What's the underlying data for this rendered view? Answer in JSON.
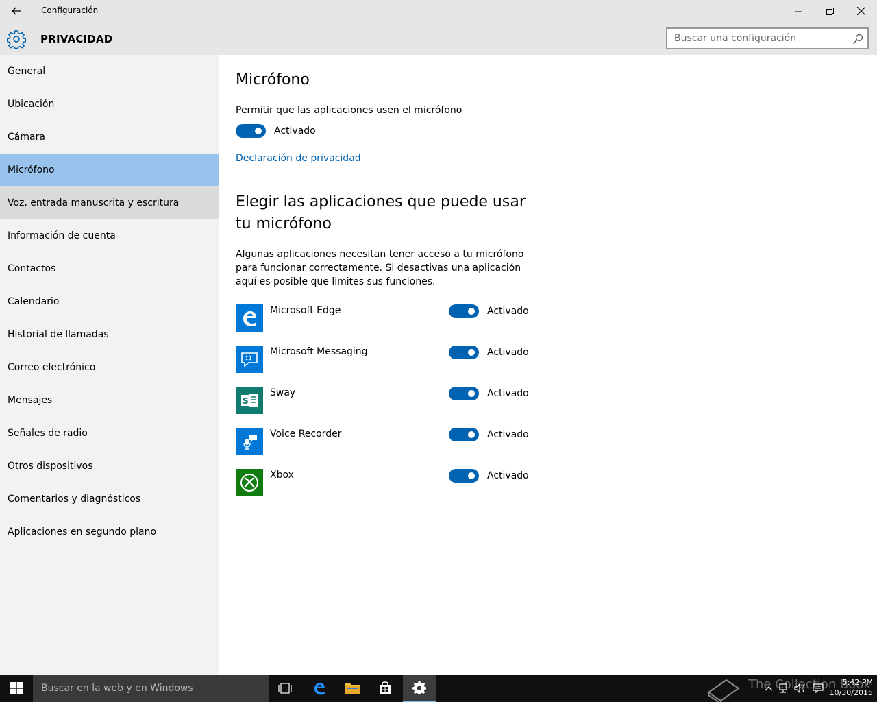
{
  "window": {
    "title": "Configuración"
  },
  "header": {
    "section_title": "PRIVACIDAD",
    "search_placeholder": "Buscar una configuración"
  },
  "sidebar": {
    "items": [
      {
        "label": "General"
      },
      {
        "label": "Ubicación"
      },
      {
        "label": "Cámara"
      },
      {
        "label": "Micrófono",
        "selected": true
      },
      {
        "label": "Voz, entrada manuscrita y escritura",
        "hover": true
      },
      {
        "label": "Información de cuenta"
      },
      {
        "label": "Contactos"
      },
      {
        "label": "Calendario"
      },
      {
        "label": "Historial de llamadas"
      },
      {
        "label": "Correo electrónico"
      },
      {
        "label": "Mensajes"
      },
      {
        "label": "Señales de radio"
      },
      {
        "label": "Otros dispositivos"
      },
      {
        "label": "Comentarios y diagnósticos"
      },
      {
        "label": "Aplicaciones en segundo plano"
      }
    ]
  },
  "main": {
    "title": "Micrófono",
    "permission_label": "Permitir que las aplicaciones usen el micrófono",
    "master_toggle": {
      "state": "on",
      "label": "Activado"
    },
    "privacy_link": "Declaración de privacidad",
    "apps_heading": "Elegir las aplicaciones que puede usar tu micrófono",
    "apps_description": "Algunas aplicaciones necesitan tener acceso a tu micrófono para funcionar correctamente. Si desactivas una aplicación aquí es posible que limites sus funciones.",
    "apps": [
      {
        "name": "Microsoft Edge",
        "icon": "edge-icon",
        "color": "#0078d7",
        "toggle_state": "on",
        "toggle_label": "Activado"
      },
      {
        "name": "Microsoft Messaging",
        "icon": "messaging-icon",
        "color": "#0078d7",
        "toggle_state": "on",
        "toggle_label": "Activado"
      },
      {
        "name": "Sway",
        "icon": "sway-icon",
        "color": "#107c6f",
        "toggle_state": "on",
        "toggle_label": "Activado"
      },
      {
        "name": "Voice Recorder",
        "icon": "voice-recorder-icon",
        "color": "#0078d7",
        "toggle_state": "on",
        "toggle_label": "Activado"
      },
      {
        "name": "Xbox",
        "icon": "xbox-icon",
        "color": "#107c10",
        "toggle_state": "on",
        "toggle_label": "Activado"
      }
    ]
  },
  "taskbar": {
    "search_placeholder": "Buscar en la web y en Windows",
    "watermark": "The Collection Book",
    "clock_time": "5:42 PM",
    "clock_date": "10/30/2015"
  },
  "colors": {
    "accent": "#0063b1",
    "selected_nav": "#99c3ec",
    "chrome_bg": "#e6e6e6",
    "sidebar_bg": "#f2f2f2",
    "taskbar_bg": "#101010"
  }
}
